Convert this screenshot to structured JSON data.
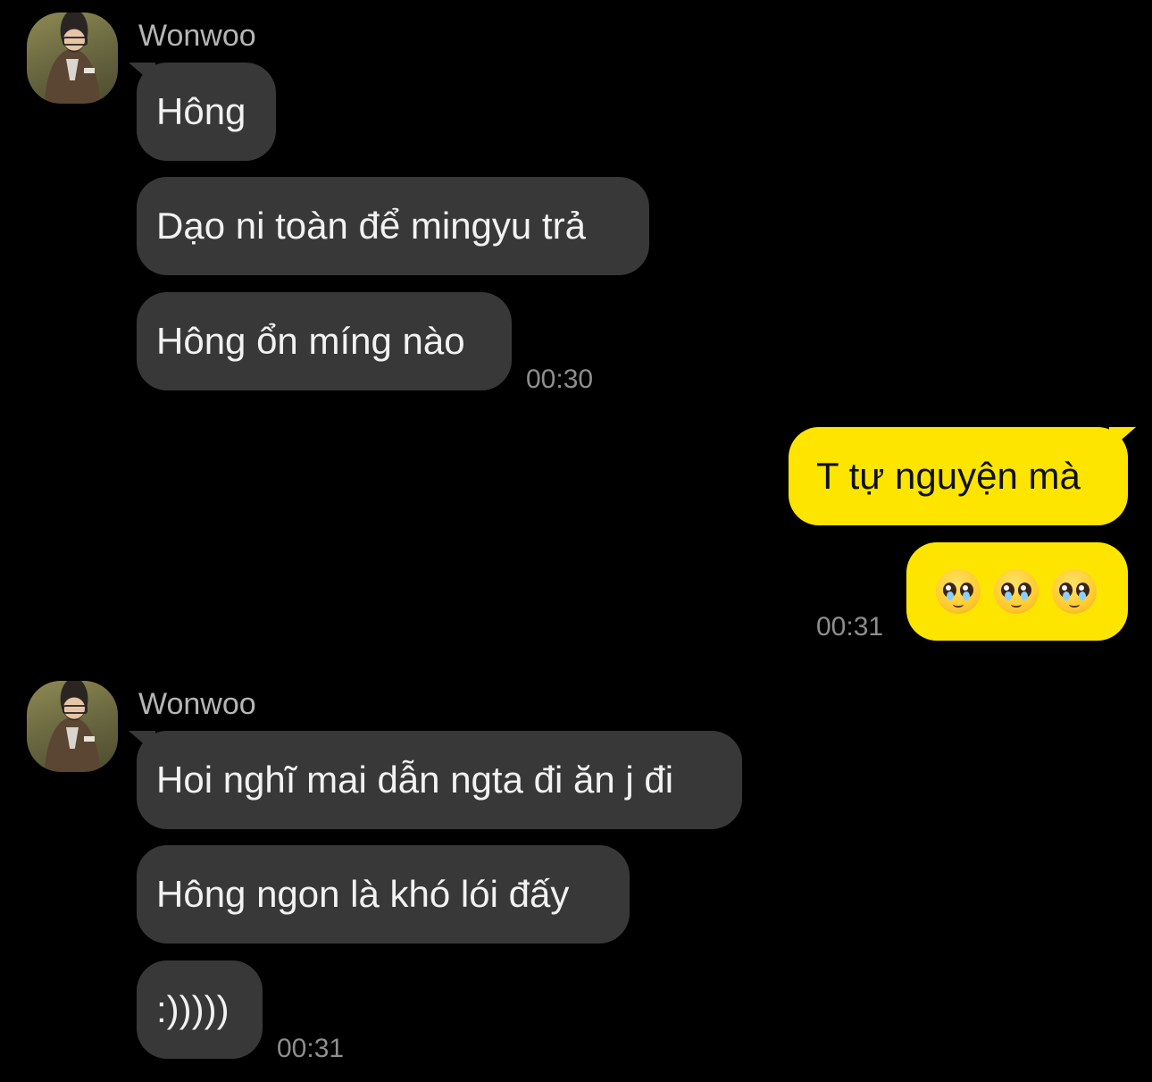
{
  "groups": [
    {
      "sender": "Wonwoo",
      "messages": [
        "Hông",
        "Dạo ni toàn để mingyu trả",
        "Hông ổn míng nào"
      ],
      "time": "00:30"
    },
    {
      "messages": [
        "T tự nguyện mà",
        "🥺🥺🥺"
      ],
      "time": "00:31"
    },
    {
      "sender": "Wonwoo",
      "messages": [
        "Hoi nghĩ mai dẫn ngta đi ăn j đi",
        "Hông ngon là khó lói đấy",
        ":)))))"
      ],
      "time": "00:31"
    }
  ],
  "colors": {
    "background": "#000000",
    "incoming_bubble": "#383839",
    "outgoing_bubble": "#fee500",
    "timestamp": "#8e8e8e",
    "sender_name": "#b5b5b5"
  },
  "icons": [
    "pleading-face-emoji"
  ]
}
